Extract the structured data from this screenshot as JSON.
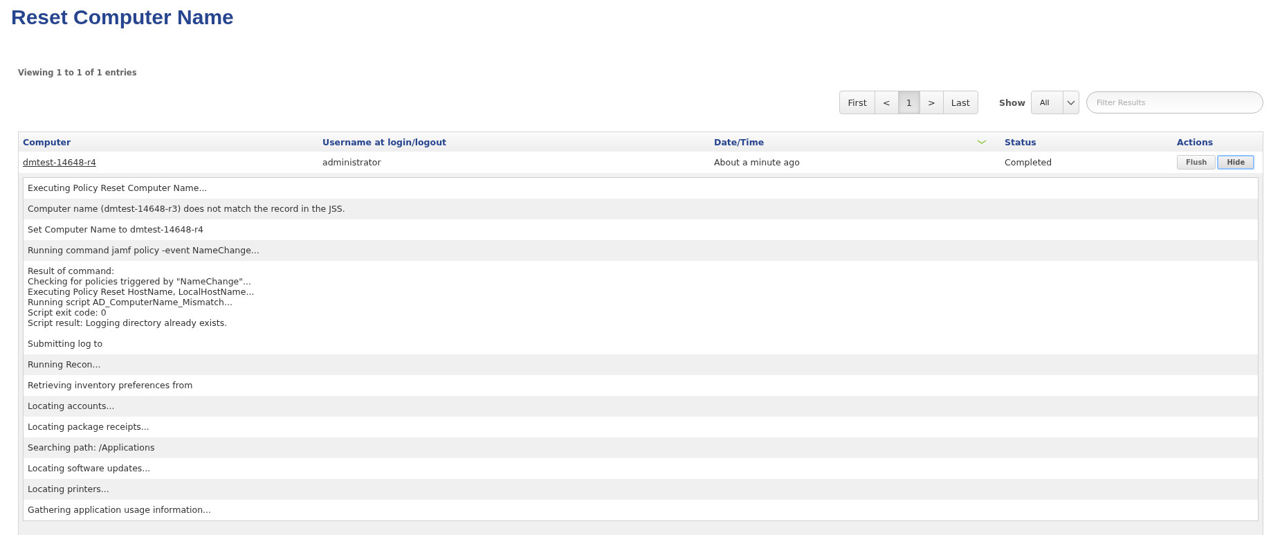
{
  "page_title": "Reset Computer Name",
  "summary": "Viewing 1 to 1 of 1 entries",
  "pagination": [
    {
      "label": "First",
      "selected": false
    },
    {
      "label": "<",
      "selected": false
    },
    {
      "label": "1",
      "selected": true
    },
    {
      "label": ">",
      "selected": false
    },
    {
      "label": "Last",
      "selected": false
    }
  ],
  "show": {
    "label": "Show",
    "value": "All"
  },
  "filter": {
    "placeholder": "Filter Results"
  },
  "table": {
    "columns": [
      "Computer",
      "Username at login/logout",
      "Date/Time",
      "Status",
      "Actions"
    ],
    "rows": [
      {
        "computer": "dmtest-14648-r4",
        "username": "administrator",
        "datetime": "About a minute ago",
        "status": "Completed",
        "actions": [
          {
            "label": "Flush",
            "focused": false
          },
          {
            "label": "Hide",
            "focused": true
          }
        ],
        "log": [
          "Executing Policy Reset Computer Name...",
          "Computer name (dmtest-14648-r3) does not match the record in the JSS.",
          "Set Computer Name to dmtest-14648-r4",
          "Running command jamf policy -event NameChange...",
          "Result of command:\nChecking for policies triggered by \"NameChange\"...\nExecuting Policy Reset HostName, LocalHostName...\nRunning script AD_ComputerName_Mismatch...\nScript exit code: 0\nScript result: Logging directory already exists.\n\nSubmitting log to",
          "Running Recon...",
          "Retrieving inventory preferences from",
          "Locating accounts...",
          "Locating package receipts...",
          "Searching path: /Applications",
          "Locating software updates...",
          "Locating printers...",
          "Gathering application usage information..."
        ]
      }
    ]
  }
}
